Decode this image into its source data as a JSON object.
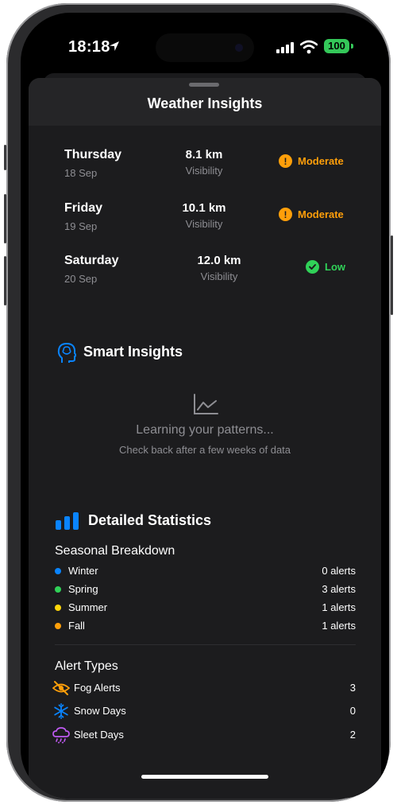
{
  "status_bar": {
    "time": "18:18",
    "battery": "100",
    "location_icon": "location-arrow-icon",
    "signal_icon": "cellular-signal-icon",
    "wifi_icon": "wifi-icon"
  },
  "sheet": {
    "title": "Weather Insights"
  },
  "forecast": [
    {
      "day": "Thursday",
      "date": "18 Sep",
      "visibility": "8.1 km",
      "visibility_label": "Visibility",
      "risk": "Moderate",
      "risk_icon": "exclamation-icon",
      "risk_color": "#ff9f0a"
    },
    {
      "day": "Friday",
      "date": "19 Sep",
      "visibility": "10.1 km",
      "visibility_label": "Visibility",
      "risk": "Moderate",
      "risk_icon": "exclamation-icon",
      "risk_color": "#ff9f0a"
    },
    {
      "day": "Saturday",
      "date": "20 Sep",
      "visibility": "12.0 km",
      "visibility_label": "Visibility",
      "risk": "Low",
      "risk_icon": "checkmark-icon",
      "risk_color": "#30d158"
    }
  ],
  "smart_insights": {
    "title": "Smart Insights",
    "icon": "brain-head-icon",
    "empty_icon": "line-chart-icon",
    "empty_title": "Learning your patterns...",
    "empty_subtitle": "Check back after a few weeks of data"
  },
  "detailed_stats": {
    "title": "Detailed Statistics",
    "icon": "bar-chart-icon",
    "seasonal_title": "Seasonal Breakdown",
    "seasons": [
      {
        "name": "Winter",
        "value": "0 alerts",
        "color": "#0a84ff"
      },
      {
        "name": "Spring",
        "value": "3 alerts",
        "color": "#30d158"
      },
      {
        "name": "Summer",
        "value": "1 alerts",
        "color": "#ffd60a"
      },
      {
        "name": "Fall",
        "value": "1 alerts",
        "color": "#ff9f0a"
      }
    ],
    "alert_types_title": "Alert Types",
    "alert_types": [
      {
        "name": "Fog Alerts",
        "value": "3",
        "icon": "eye-slash-icon",
        "color": "#ff9f0a"
      },
      {
        "name": "Snow Days",
        "value": "0",
        "icon": "snowflake-icon",
        "color": "#0a84ff"
      },
      {
        "name": "Sleet Days",
        "value": "2",
        "icon": "cloud-sleet-icon",
        "color": "#bf5af2"
      }
    ]
  },
  "colors": {
    "background": "#1c1c1e",
    "accent_blue": "#0a84ff",
    "moderate": "#ff9f0a",
    "low": "#30d158"
  }
}
